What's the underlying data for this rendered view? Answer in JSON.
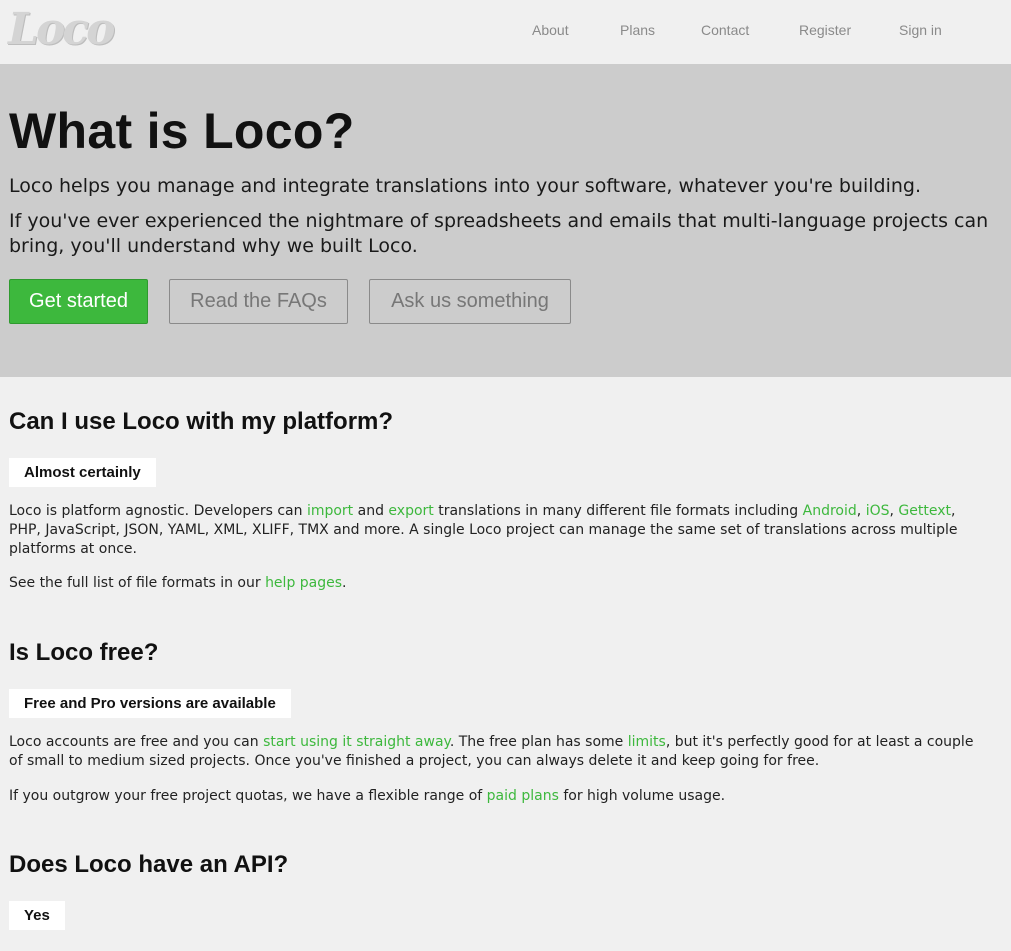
{
  "header": {
    "logo": "Loco",
    "nav": [
      "About",
      "Plans",
      "Contact",
      "Register",
      "Sign in"
    ]
  },
  "hero": {
    "title": "What is Loco?",
    "line1": "Loco helps you manage and integrate translations into your software, whatever you're building.",
    "line2a": "If you've ever experienced the nightmare of spreadsheets and emails that multi-language projects can",
    "line2b": "bring, you'll understand why we built Loco.",
    "buttons": {
      "start": "Get started",
      "faq": "Read the FAQs",
      "ask": "Ask us something"
    }
  },
  "faq": [
    {
      "question": "Can I use Loco with my platform?",
      "answer_badge": "Almost certainly",
      "p1": {
        "t1": "Loco is platform agnostic. Developers can ",
        "l1": "import",
        "t2": " and ",
        "l2": "export",
        "t3": " translations in many different file formats including ",
        "l3": "Android",
        "t4": ", ",
        "l4": "iOS",
        "t5": ", ",
        "l5": "Gettext",
        "t6": ", PHP, JavaScript, JSON, YAML, XML, XLIFF, TMX and more. A single Loco project can manage the same set of translations across multiple platforms at once."
      },
      "p2": {
        "t1": "See the full list of file formats in our ",
        "l1": "help pages",
        "t2": "."
      }
    },
    {
      "question": "Is Loco free?",
      "answer_badge": "Free and Pro versions are available",
      "p1": {
        "t1": "Loco accounts are free and you can ",
        "l1": "start using it straight away",
        "t2": ". The free plan has some ",
        "l2": "limits",
        "t3": ", but it's perfectly good for at least a couple of small to medium sized projects. Once you've finished a project, you can always delete it and keep going for free."
      },
      "p2": {
        "t1": "If you outgrow your free project quotas, we have a flexible range of ",
        "l1": "paid plans",
        "t2": " for high volume usage."
      }
    },
    {
      "question": "Does Loco have an API?",
      "answer_badge": "Yes"
    }
  ],
  "colors": {
    "accent": "#3db83d",
    "hero_bg": "#cccccc",
    "page_bg": "#f0f0f0"
  }
}
